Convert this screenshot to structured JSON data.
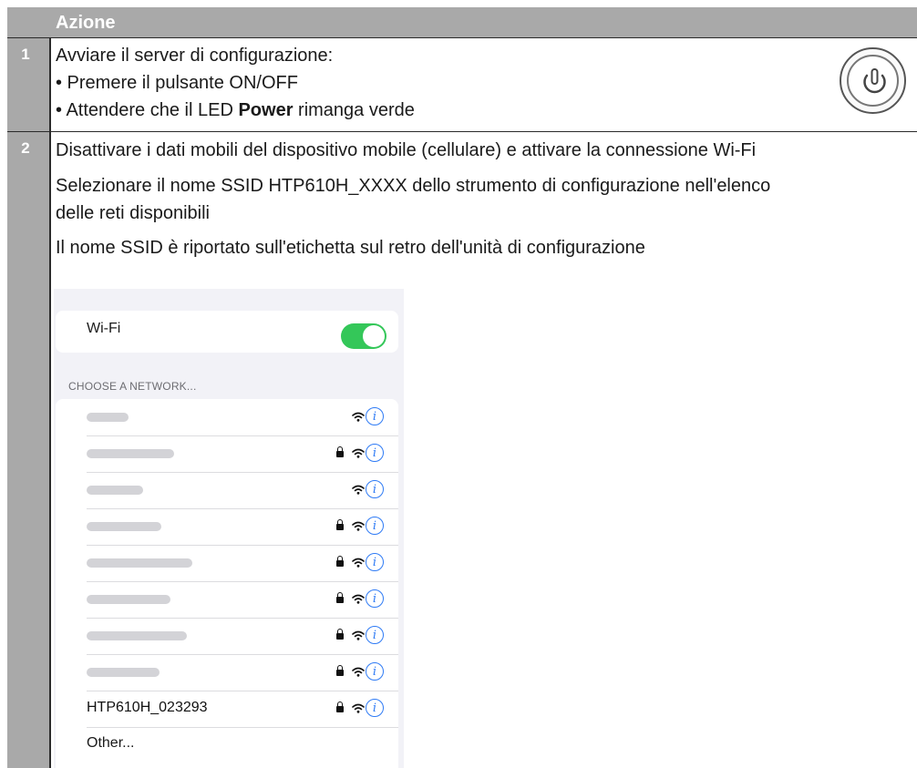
{
  "header": {
    "action_label": "Azione"
  },
  "steps": [
    {
      "number": "1",
      "lines": {
        "intro": "Avviare il server di configurazione:",
        "bullet1": "• Premere il pulsante ON/OFF",
        "bullet2_pre": "• Attendere che il LED ",
        "bullet2_bold": "Power",
        "bullet2_post": " rimanga verde"
      },
      "icon": "power-button-icon"
    },
    {
      "number": "2",
      "lines": {
        "p1": "Disattivare i dati mobili del dispositivo mobile (cellulare) e attivare la connessione Wi-Fi",
        "p2a": "Selezionare il nome SSID HTP610H_XXXX dello strumento di configurazione nell'elenco",
        "p2b": "delle reti disponibili",
        "p3": "Il nome SSID è riportato sull'etichetta sul retro dell'unità di configurazione"
      }
    }
  ],
  "phone": {
    "wifi_label": "Wi-Fi",
    "wifi_enabled": true,
    "choose_label": "CHOOSE A NETWORK...",
    "networks": [
      {
        "name": "",
        "locked": false,
        "blurred": true
      },
      {
        "name": "",
        "locked": true,
        "blurred": true
      },
      {
        "name": "",
        "locked": false,
        "blurred": true
      },
      {
        "name": "",
        "locked": true,
        "blurred": true
      },
      {
        "name": "",
        "locked": true,
        "blurred": true
      },
      {
        "name": "",
        "locked": true,
        "blurred": true
      },
      {
        "name": "",
        "locked": true,
        "blurred": true
      },
      {
        "name": "",
        "locked": true,
        "blurred": true
      },
      {
        "name": "HTP610H_023293",
        "locked": true,
        "blurred": false
      }
    ],
    "other_label": "Other...",
    "info_glyph": "i"
  }
}
